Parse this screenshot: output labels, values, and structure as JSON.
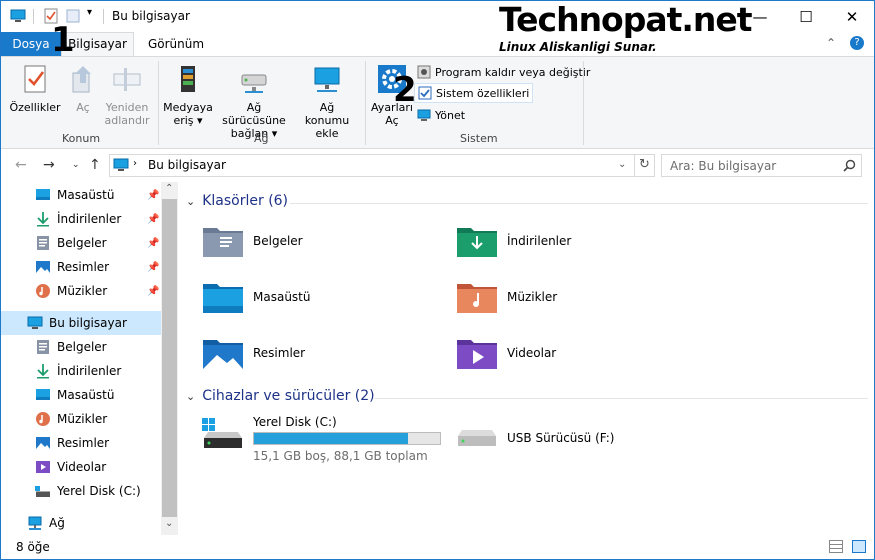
{
  "title": "Bu bilgisayar",
  "watermark": {
    "main": "Technopat.net",
    "sub": "Linux Aliskanligi Sunar."
  },
  "callouts": [
    "1",
    "2"
  ],
  "window_controls": {
    "minimize": "—",
    "maximize": "☐",
    "close": "✕"
  },
  "tabs": {
    "file": "Dosya",
    "computer": "Bilgisayar",
    "view": "Görünüm"
  },
  "ribbon": {
    "konum": {
      "label": "Konum",
      "properties": "Özellikler",
      "open": "Aç",
      "rename": "Yeniden adlandır"
    },
    "ag": {
      "label": "Ağ",
      "media_line1": "Medyaya",
      "media_line2": "eriş",
      "map_line1": "Ağ sürücüsüne",
      "map_line2": "bağlan",
      "add_line1": "Ağ konumu",
      "add_line2": "ekle"
    },
    "sistem": {
      "label": "Sistem",
      "settings_line1": "Ayarları",
      "settings_line2": "Aç",
      "uninstall": "Program kaldır veya değiştir",
      "system_props": "Sistem özellikleri",
      "manage": "Yönet"
    }
  },
  "address": {
    "path": "Bu bilgisayar",
    "search_placeholder": "Ara: Bu bilgisayar"
  },
  "nav_pane": {
    "quick_access": [
      "Masaüstü",
      "İndirilenler",
      "Belgeler",
      "Resimler",
      "Müzikler"
    ],
    "this_pc": "Bu bilgisayar",
    "this_pc_items": [
      "Belgeler",
      "İndirilenler",
      "Masaüstü",
      "Müzikler",
      "Resimler",
      "Videolar",
      "Yerel Disk (C:)"
    ],
    "network": "Ağ"
  },
  "content": {
    "folders_header": "Klasörler (6)",
    "folders": [
      "Belgeler",
      "İndirilenler",
      "Masaüstü",
      "Müzikler",
      "Resimler",
      "Videolar"
    ],
    "devices_header": "Cihazlar ve sürücüler (2)",
    "drive_c": {
      "name": "Yerel Disk (C:)",
      "info": "15,1 GB boş, 88,1 GB toplam",
      "used_fraction": 0.83
    },
    "drive_f": {
      "name": "USB Sürücüsü (F:)"
    }
  },
  "status": {
    "count": "8 öğe"
  },
  "colors": {
    "accent": "#1979ca",
    "header_blue": "#1e3287",
    "drive_bar": "#26a0da"
  }
}
